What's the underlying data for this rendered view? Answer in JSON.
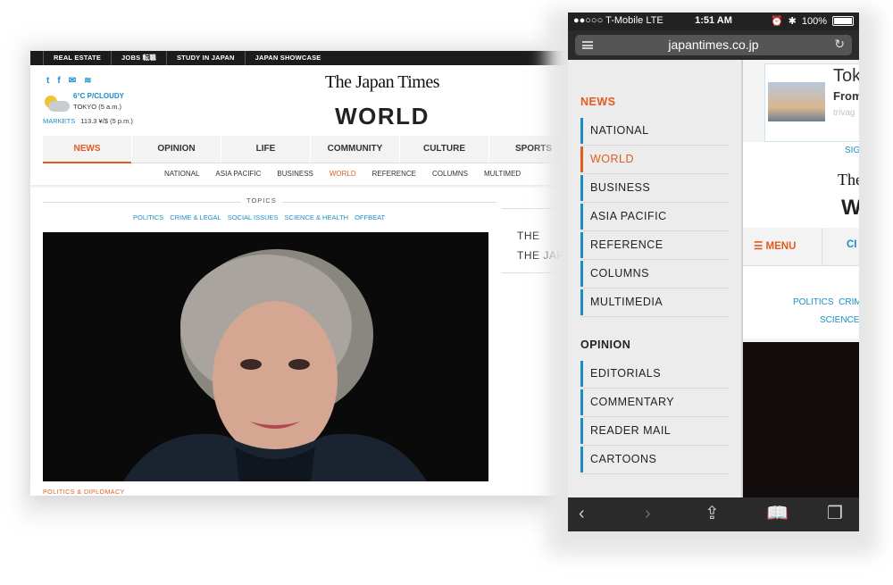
{
  "desktop": {
    "topbar": [
      "REAL ESTATE",
      "JOBS 転職",
      "STUDY IN JAPAN",
      "JAPAN SHOWCASE"
    ],
    "social_icons": [
      "twitter-icon",
      "facebook-icon",
      "email-icon",
      "rss-icon"
    ],
    "weather": {
      "temp": "6°C",
      "condition": "P/CLOUDY",
      "city": "TOKYO (5 a.m.)"
    },
    "markets": {
      "label": "MARKETS",
      "value": "113.3 ¥/$ (5 p.m.)"
    },
    "masthead": "The Japan Times",
    "section_title": "WORLD",
    "nav": [
      "NEWS",
      "OPINION",
      "LIFE",
      "COMMUNITY",
      "CULTURE",
      "SPORTS"
    ],
    "subnav": [
      "NATIONAL",
      "ASIA PACIFIC",
      "BUSINESS",
      "WORLD",
      "REFERENCE",
      "COLUMNS",
      "MULTIMED"
    ],
    "topics_label": "TOPICS",
    "topics": [
      "POLITICS",
      "CRIME & LEGAL",
      "SOCIAL ISSUES",
      "SCIENCE & HEALTH",
      "OFFBEAT"
    ],
    "right_blurb": [
      "THE",
      "THE JAP"
    ],
    "kicker": "POLITICS & DIPLOMACY",
    "accent": "#e35b1e",
    "link_color": "#1a8dc8"
  },
  "phone": {
    "status": {
      "carrier": "●●○○○ T-Mobile  LTE",
      "time": "1:51 AM",
      "battery": "100%"
    },
    "url": "japantimes.co.jp",
    "menu": {
      "news_heading": "NEWS",
      "news_items": [
        "NATIONAL",
        "WORLD",
        "BUSINESS",
        "ASIA PACIFIC",
        "REFERENCE",
        "COLUMNS",
        "MULTIMEDIA"
      ],
      "opinion_heading": "OPINION",
      "opinion_items": [
        "EDITORIALS",
        "COMMENTARY",
        "READER MAIL",
        "CARTOONS"
      ]
    },
    "site": {
      "ad_title": "Tok",
      "ad_sub": "From",
      "ad_brand": "trivag",
      "sign": "SIG",
      "masthead": "The",
      "section": "W",
      "menu_label": "MENU",
      "nav_cut": "CI",
      "topics_line1": [
        "POLITICS",
        "CRIM"
      ],
      "topics_line2": [
        "SCIENCE"
      ]
    },
    "toolbar": [
      "back-icon",
      "forward-icon",
      "share-icon",
      "bookmarks-icon",
      "tabs-icon"
    ]
  }
}
